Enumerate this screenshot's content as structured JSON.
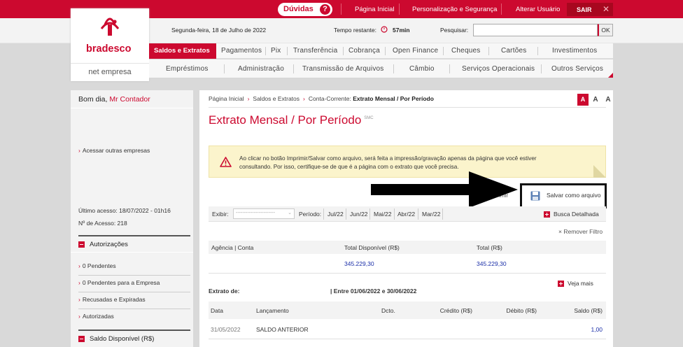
{
  "topbar": {
    "duvidas": "Dúvidas",
    "duvidas_icon": "?",
    "links": [
      "Página Inicial",
      "Personalização e Segurança",
      "Alterar Usuário"
    ],
    "sair": "SAIR",
    "close": "✕"
  },
  "brand": {
    "name": "bradesco",
    "product": "net empresa"
  },
  "header": {
    "date": "Segunda-feira, 18 de Julho de 2022",
    "timer_label": "Tempo restante:",
    "timer_value": "57min",
    "search_label": "Pesquisar:",
    "search_value": "",
    "ok": "OK"
  },
  "nav": {
    "primary": [
      "Saldos e Extratos",
      "Pagamentos",
      "Pix",
      "Transferência",
      "Cobrança",
      "Open Finance",
      "Cheques",
      "Cartões",
      "Investimentos"
    ],
    "secondary": [
      "Empréstimos",
      "Administração",
      "Transmissão de Arquivos",
      "Câmbio",
      "Serviços Operacionais",
      "Outros Serviços"
    ]
  },
  "sidebar": {
    "greeting": "Bom dia,",
    "user": "Mr Contador",
    "other_companies": "Acessar outras empresas",
    "last_access": "Último acesso: 18/07/2022 - 01h16",
    "access_count": "Nº de Acesso: 218",
    "auth_title": "Autorizações",
    "auth_items": [
      "0 Pendentes",
      "0 Pendentes para a Empresa",
      "Recusadas e Expiradas",
      "Autorizadas"
    ],
    "balance_title": "Saldo Disponível (R$)"
  },
  "breadcrumb": {
    "items": [
      "Página Inicial",
      "Saldos e Extratos"
    ],
    "current_prefix": "Conta-Corrente:",
    "current": "Extrato Mensal / Por Período"
  },
  "font_sizes": [
    "A",
    "A",
    "A"
  ],
  "page": {
    "title": "Extrato Mensal / Por Período",
    "title_sup": "SMC",
    "alert_line1": "Ao clicar no botão Imprimir/Salvar como arquivo, será feita a impressão/gravação apenas da página que você estiver",
    "alert_line2": "consultando. Por isso, certifique-se de que é a página com o extrato que você precisa.",
    "imprimir": "primir",
    "save_label": "Salvar como arquivo"
  },
  "filter": {
    "exibir": "Exibir:",
    "select_value": "------------------------",
    "periodo": "Período:",
    "months": [
      "Jul/22",
      "Jun/22",
      "Mai/22",
      "Abr/22",
      "Mar/22"
    ],
    "busca": "Busca Detalhada",
    "remover": "× Remover Filtro"
  },
  "summary": {
    "headers": [
      "Agência | Conta",
      "Total Disponível (R$)",
      "Total (R$)"
    ],
    "total_disponivel": "345.229,30",
    "total": "345.229,30"
  },
  "extrato": {
    "label": "Extrato de:",
    "period": "| Entre 01/06/2022 e 30/06/2022",
    "veja_mais": "Veja mais",
    "columns": [
      "Data",
      "Lançamento",
      "Dcto.",
      "Crédito (R$)",
      "Débito (R$)",
      "Saldo (R$)"
    ],
    "rows": [
      {
        "data": "31/05/2022",
        "lancamento": "SALDO ANTERIOR",
        "dcto": "",
        "credito": "",
        "debito": "",
        "saldo": "1,00"
      }
    ]
  },
  "icons": {
    "warning": "warning-icon",
    "save": "floppy-disk-icon",
    "timer": "clock-icon",
    "arrow": "annotation-arrow"
  },
  "colors": {
    "brand_red": "#cc092f",
    "link_blue": "#1a2ea8",
    "alert_bg": "#fbf4cc"
  }
}
